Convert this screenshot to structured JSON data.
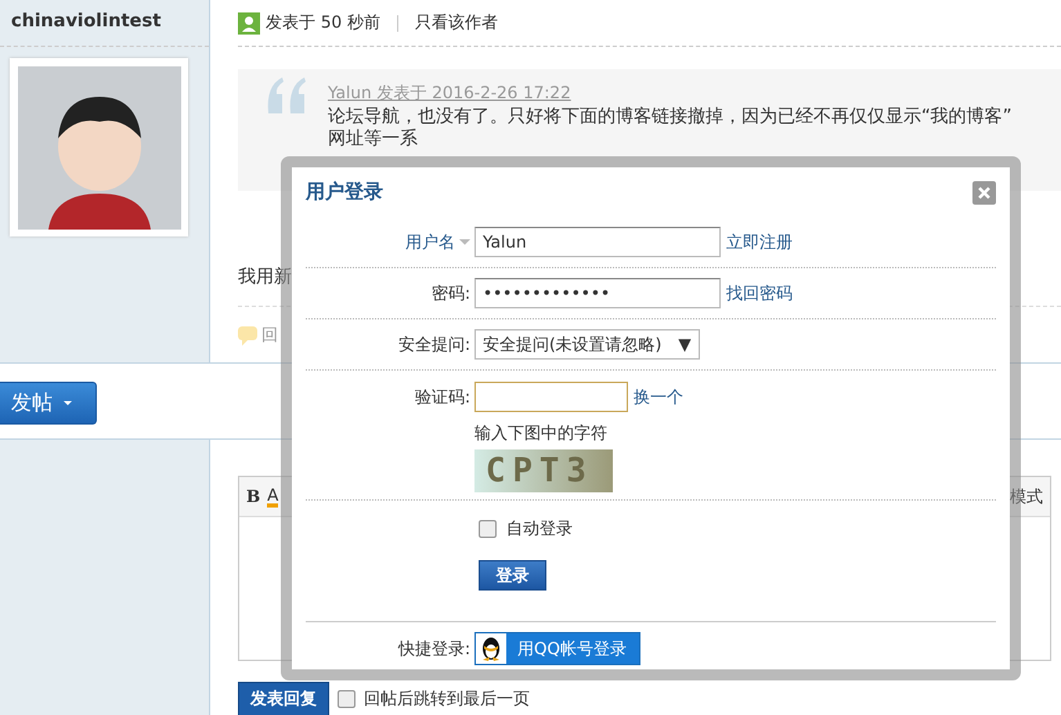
{
  "sidebar": {
    "username": "chinaviolintest"
  },
  "post": {
    "meta": "发表于 50 秒前",
    "author_only_link": "只看该作者",
    "quote": {
      "attribution": "Yalun 发表于 2016-2-26 17:22",
      "text": "论坛导航，也没有了。只好将下面的博客链接撤掉，因为已经不再仅仅显示“我的博客”",
      "text_2": "网址等一系"
    },
    "body": "我用新",
    "reply_link": "回"
  },
  "post_button": {
    "label": "发帖"
  },
  "editor": {
    "toolbar": [
      "B",
      "A"
    ],
    "mode_label": "模式"
  },
  "reply_button": "发表回复",
  "jump_checkbox": {
    "label": "回帖后跳转到最后一页",
    "checked": false
  },
  "login_dialog": {
    "title": "用户登录",
    "fields": [
      {
        "kind": "text",
        "label": "用户名",
        "value": "Yalun",
        "link": "立即注册"
      },
      {
        "kind": "password",
        "label": "密码:",
        "value": "•••••••••••••",
        "link": "找回密码"
      },
      {
        "kind": "select",
        "label": "安全提问:",
        "value": "安全提问(未设置请忽略)",
        "arrow": "▼"
      },
      {
        "kind": "captcha",
        "label": "验证码:",
        "link": "换一个",
        "hint": "输入下图中的字符",
        "captcha_text": "CPT3"
      }
    ],
    "auto_login": {
      "label": "自动登录",
      "checked": false
    },
    "login_button": "登录",
    "quick_login": {
      "label": "快捷登录:",
      "button": "用QQ帐号登录"
    }
  }
}
